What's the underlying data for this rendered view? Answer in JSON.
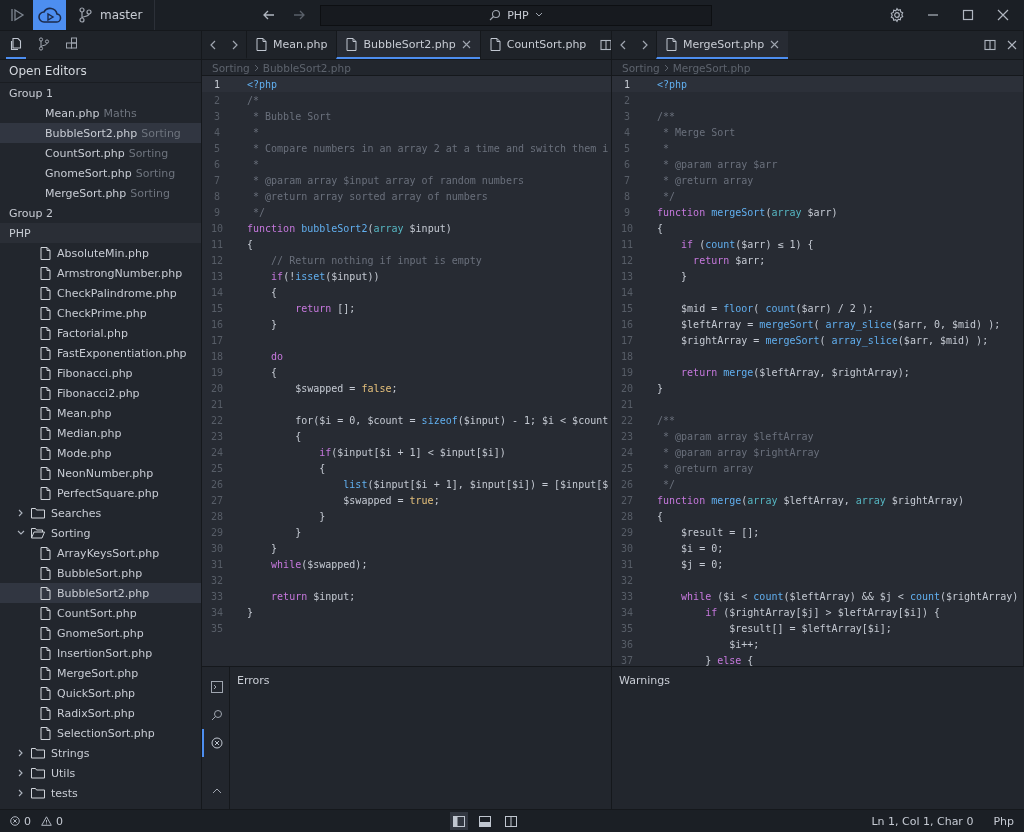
{
  "top_bar": {
    "branch": "master",
    "command": "PHP"
  },
  "sidebar": {
    "tabs": [
      {
        "kind": "files",
        "selected": true
      },
      {
        "kind": "branch",
        "selected": false
      },
      {
        "kind": "extensions",
        "selected": false
      }
    ],
    "open_editors": {
      "title": "Open Editors",
      "groups": [
        {
          "name": "Group 1",
          "items": [
            {
              "name": "Mean.php",
              "folder": "Maths",
              "selected": false
            },
            {
              "name": "BubbleSort2.php",
              "folder": "Sorting",
              "selected": true
            },
            {
              "name": "CountSort.php",
              "folder": "Sorting",
              "selected": false
            },
            {
              "name": "GnomeSort.php",
              "folder": "Sorting",
              "selected": false
            },
            {
              "name": "MergeSort.php",
              "folder": "Sorting",
              "selected": false
            }
          ]
        },
        {
          "name": "Group 2"
        }
      ]
    },
    "explorer": {
      "title": "PHP",
      "items": [
        {
          "kind": "file",
          "name": "AbsoluteMin.php",
          "selected": false
        },
        {
          "kind": "file",
          "name": "ArmstrongNumber.php",
          "selected": false
        },
        {
          "kind": "file",
          "name": "CheckPalindrome.php",
          "selected": false
        },
        {
          "kind": "file",
          "name": "CheckPrime.php",
          "selected": false
        },
        {
          "kind": "file",
          "name": "Factorial.php",
          "selected": false
        },
        {
          "kind": "file",
          "name": "FastExponentiation.php",
          "selected": false
        },
        {
          "kind": "file",
          "name": "Fibonacci.php",
          "selected": false
        },
        {
          "kind": "file",
          "name": "Fibonacci2.php",
          "selected": false
        },
        {
          "kind": "file",
          "name": "Mean.php",
          "selected": false
        },
        {
          "kind": "file",
          "name": "Median.php",
          "selected": false
        },
        {
          "kind": "file",
          "name": "Mode.php",
          "selected": false
        },
        {
          "kind": "file",
          "name": "NeonNumber.php",
          "selected": false
        },
        {
          "kind": "file",
          "name": "PerfectSquare.php",
          "selected": false
        },
        {
          "kind": "folder",
          "name": "Searches",
          "expanded": false
        },
        {
          "kind": "folder",
          "name": "Sorting",
          "expanded": true,
          "children": [
            {
              "kind": "file",
              "name": "ArrayKeysSort.php",
              "selected": false
            },
            {
              "kind": "file",
              "name": "BubbleSort.php",
              "selected": false
            },
            {
              "kind": "file",
              "name": "BubbleSort2.php",
              "selected": true
            },
            {
              "kind": "file",
              "name": "CountSort.php",
              "selected": false
            },
            {
              "kind": "file",
              "name": "GnomeSort.php",
              "selected": false
            },
            {
              "kind": "file",
              "name": "InsertionSort.php",
              "selected": false
            },
            {
              "kind": "file",
              "name": "MergeSort.php",
              "selected": false
            },
            {
              "kind": "file",
              "name": "QuickSort.php",
              "selected": false
            },
            {
              "kind": "file",
              "name": "RadixSort.php",
              "selected": false
            },
            {
              "kind": "file",
              "name": "SelectionSort.php",
              "selected": false
            }
          ]
        },
        {
          "kind": "folder",
          "name": "Strings",
          "expanded": false
        },
        {
          "kind": "folder",
          "name": "Utils",
          "expanded": false
        },
        {
          "kind": "folder",
          "name": "tests",
          "expanded": false
        }
      ]
    }
  },
  "editors": [
    {
      "tabs": [
        {
          "label": "Mean.php",
          "selected": false
        },
        {
          "label": "BubbleSort2.php",
          "selected": true
        },
        {
          "label": "CountSort.php",
          "selected": false
        }
      ],
      "breadcrumb": [
        "Sorting",
        "BubbleSort2.php"
      ],
      "lines": [
        {
          "n": "1",
          "current": true,
          "code": [
            {
              "kind": "tag",
              "text": "<?php"
            }
          ]
        },
        {
          "n": "2",
          "current": false,
          "code": [
            {
              "kind": "comment",
              "text": "/*"
            }
          ]
        },
        {
          "n": "3",
          "current": false,
          "code": [
            {
              "kind": "comment",
              "text": " * Bubble Sort"
            }
          ]
        },
        {
          "n": "4",
          "current": false,
          "code": [
            {
              "kind": "comment",
              "text": " *"
            }
          ]
        },
        {
          "n": "5",
          "current": false,
          "code": [
            {
              "kind": "comment",
              "text": " * Compare numbers in an array 2 at a time and switch them i"
            }
          ]
        },
        {
          "n": "6",
          "current": false,
          "code": [
            {
              "kind": "comment",
              "text": " *"
            }
          ]
        },
        {
          "n": "7",
          "current": false,
          "code": [
            {
              "kind": "comment",
              "text": " * @param array $input array of random numbers"
            }
          ]
        },
        {
          "n": "8",
          "current": false,
          "code": [
            {
              "kind": "comment",
              "text": " * @return array sorted array of numbers"
            }
          ]
        },
        {
          "n": "9",
          "current": false,
          "code": [
            {
              "kind": "comment",
              "text": " */"
            }
          ]
        },
        {
          "n": "10",
          "current": false,
          "code": [
            {
              "kind": "keyword",
              "text": "function "
            },
            {
              "kind": "function",
              "text": "bubbleSort2"
            },
            {
              "kind": "plain",
              "text": "("
            },
            {
              "kind": "type",
              "text": "array"
            },
            {
              "kind": "plain",
              "text": " $input)"
            }
          ]
        },
        {
          "n": "11",
          "current": false,
          "code": [
            {
              "kind": "plain",
              "text": "{"
            }
          ]
        },
        {
          "n": "12",
          "current": false,
          "code": [
            {
              "kind": "comment",
              "text": "    // Return nothing if input is empty"
            }
          ]
        },
        {
          "n": "13",
          "current": false,
          "code": [
            {
              "kind": "keyword",
              "text": "    if"
            },
            {
              "kind": "plain",
              "text": "(!"
            },
            {
              "kind": "function",
              "text": "isset"
            },
            {
              "kind": "plain",
              "text": "($input))"
            }
          ]
        },
        {
          "n": "14",
          "current": false,
          "code": [
            {
              "kind": "plain",
              "text": "    {"
            }
          ]
        },
        {
          "n": "15",
          "current": false,
          "code": [
            {
              "kind": "keyword",
              "text": "        return"
            },
            {
              "kind": "plain",
              "text": " [];"
            }
          ]
        },
        {
          "n": "16",
          "current": false,
          "code": [
            {
              "kind": "plain",
              "text": "    }"
            }
          ]
        },
        {
          "n": "17",
          "current": false
        },
        {
          "n": "18",
          "current": false,
          "code": [
            {
              "kind": "keyword",
              "text": "    do"
            }
          ]
        },
        {
          "n": "19",
          "current": false,
          "code": [
            {
              "kind": "plain",
              "text": "    {"
            }
          ]
        },
        {
          "n": "20",
          "current": false,
          "code": [
            {
              "kind": "plain",
              "text": "        $swapped = "
            },
            {
              "kind": "constant",
              "text": "false"
            },
            {
              "kind": "plain",
              "text": ";"
            }
          ]
        },
        {
          "n": "21",
          "current": false
        },
        {
          "n": "22",
          "current": false,
          "code": [
            {
              "kind": "plain",
              "text": "        for($i = 0, $count = "
            },
            {
              "kind": "function",
              "text": "sizeof"
            },
            {
              "kind": "plain",
              "text": "($input) - 1; $i < $count"
            }
          ]
        },
        {
          "n": "23",
          "current": false,
          "code": [
            {
              "kind": "plain",
              "text": "        {"
            }
          ]
        },
        {
          "n": "24",
          "current": false,
          "code": [
            {
              "kind": "keyword",
              "text": "            if"
            },
            {
              "kind": "plain",
              "text": "($input[$i + 1] < $input[$i])"
            }
          ]
        },
        {
          "n": "25",
          "current": false,
          "code": [
            {
              "kind": "plain",
              "text": "            {"
            }
          ]
        },
        {
          "n": "26",
          "current": false,
          "code": [
            {
              "kind": "function",
              "text": "                list"
            },
            {
              "kind": "plain",
              "text": "($input[$i + 1], $input[$i]) = [$input[$"
            }
          ]
        },
        {
          "n": "27",
          "current": false,
          "code": [
            {
              "kind": "plain",
              "text": "                $swapped = "
            },
            {
              "kind": "constant",
              "text": "true"
            },
            {
              "kind": "plain",
              "text": ";"
            }
          ]
        },
        {
          "n": "28",
          "current": false,
          "code": [
            {
              "kind": "plain",
              "text": "            }"
            }
          ]
        },
        {
          "n": "29",
          "current": false,
          "code": [
            {
              "kind": "plain",
              "text": "        }"
            }
          ]
        },
        {
          "n": "30",
          "current": false,
          "code": [
            {
              "kind": "plain",
              "text": "    }"
            }
          ]
        },
        {
          "n": "31",
          "current": false,
          "code": [
            {
              "kind": "keyword",
              "text": "    while"
            },
            {
              "kind": "plain",
              "text": "($swapped);"
            }
          ]
        },
        {
          "n": "32",
          "current": false
        },
        {
          "n": "33",
          "current": false,
          "code": [
            {
              "kind": "keyword",
              "text": "    return"
            },
            {
              "kind": "plain",
              "text": " $input;"
            }
          ]
        },
        {
          "n": "34",
          "current": false,
          "code": [
            {
              "kind": "plain",
              "text": "}"
            }
          ]
        },
        {
          "n": "35",
          "current": false
        }
      ]
    },
    {
      "tabs": [
        {
          "label": "MergeSort.php",
          "selected": true
        }
      ],
      "breadcrumb": [
        "Sorting",
        "MergeSort.php"
      ],
      "lines": [
        {
          "n": "1",
          "current": true,
          "code": [
            {
              "kind": "tag",
              "text": "<?php"
            }
          ]
        },
        {
          "n": "2",
          "current": false
        },
        {
          "n": "3",
          "current": false,
          "code": [
            {
              "kind": "comment",
              "text": "/**"
            }
          ]
        },
        {
          "n": "4",
          "current": false,
          "code": [
            {
              "kind": "comment",
              "text": " * Merge Sort"
            }
          ]
        },
        {
          "n": "5",
          "current": false,
          "code": [
            {
              "kind": "comment",
              "text": " *"
            }
          ]
        },
        {
          "n": "6",
          "current": false,
          "code": [
            {
              "kind": "comment",
              "text": " * @param array $arr"
            }
          ]
        },
        {
          "n": "7",
          "current": false,
          "code": [
            {
              "kind": "comment",
              "text": " * @return array"
            }
          ]
        },
        {
          "n": "8",
          "current": false,
          "code": [
            {
              "kind": "comment",
              "text": " */"
            }
          ]
        },
        {
          "n": "9",
          "current": false,
          "code": [
            {
              "kind": "keyword",
              "text": "function "
            },
            {
              "kind": "function",
              "text": "mergeSort"
            },
            {
              "kind": "plain",
              "text": "("
            },
            {
              "kind": "type",
              "text": "array"
            },
            {
              "kind": "plain",
              "text": " $arr)"
            }
          ]
        },
        {
          "n": "10",
          "current": false,
          "code": [
            {
              "kind": "plain",
              "text": "{"
            }
          ]
        },
        {
          "n": "11",
          "current": false,
          "code": [
            {
              "kind": "keyword",
              "text": "    if"
            },
            {
              "kind": "plain",
              "text": " ("
            },
            {
              "kind": "function",
              "text": "count"
            },
            {
              "kind": "plain",
              "text": "($arr) ≤ 1) {"
            }
          ]
        },
        {
          "n": "12",
          "current": false,
          "code": [
            {
              "kind": "keyword",
              "text": "      return"
            },
            {
              "kind": "plain",
              "text": " $arr;"
            }
          ]
        },
        {
          "n": "13",
          "current": false,
          "code": [
            {
              "kind": "plain",
              "text": "    }"
            }
          ]
        },
        {
          "n": "14",
          "current": false
        },
        {
          "n": "15",
          "current": false,
          "code": [
            {
              "kind": "plain",
              "text": "    $mid = "
            },
            {
              "kind": "function",
              "text": "floor"
            },
            {
              "kind": "plain",
              "text": "( "
            },
            {
              "kind": "function",
              "text": "count"
            },
            {
              "kind": "plain",
              "text": "($arr) / 2 );"
            }
          ]
        },
        {
          "n": "16",
          "current": false,
          "code": [
            {
              "kind": "plain",
              "text": "    $leftArray = "
            },
            {
              "kind": "function",
              "text": "mergeSort"
            },
            {
              "kind": "plain",
              "text": "( "
            },
            {
              "kind": "function",
              "text": "array_slice"
            },
            {
              "kind": "plain",
              "text": "($arr, 0, $mid) );"
            }
          ]
        },
        {
          "n": "17",
          "current": false,
          "code": [
            {
              "kind": "plain",
              "text": "    $rightArray = "
            },
            {
              "kind": "function",
              "text": "mergeSort"
            },
            {
              "kind": "plain",
              "text": "( "
            },
            {
              "kind": "function",
              "text": "array_slice"
            },
            {
              "kind": "plain",
              "text": "($arr, $mid) );"
            }
          ]
        },
        {
          "n": "18",
          "current": false
        },
        {
          "n": "19",
          "current": false,
          "code": [
            {
              "kind": "keyword",
              "text": "    return"
            },
            {
              "kind": "function",
              "text": " merge"
            },
            {
              "kind": "plain",
              "text": "($leftArray, $rightArray);"
            }
          ]
        },
        {
          "n": "20",
          "current": false,
          "code": [
            {
              "kind": "plain",
              "text": "}"
            }
          ]
        },
        {
          "n": "21",
          "current": false
        },
        {
          "n": "22",
          "current": false,
          "code": [
            {
              "kind": "comment",
              "text": "/**"
            }
          ]
        },
        {
          "n": "23",
          "current": false,
          "code": [
            {
              "kind": "comment",
              "text": " * @param array $leftArray"
            }
          ]
        },
        {
          "n": "24",
          "current": false,
          "code": [
            {
              "kind": "comment",
              "text": " * @param array $rightArray"
            }
          ]
        },
        {
          "n": "25",
          "current": false,
          "code": [
            {
              "kind": "comment",
              "text": " * @return array"
            }
          ]
        },
        {
          "n": "26",
          "current": false,
          "code": [
            {
              "kind": "comment",
              "text": " */"
            }
          ]
        },
        {
          "n": "27",
          "current": false,
          "code": [
            {
              "kind": "keyword",
              "text": "function "
            },
            {
              "kind": "function",
              "text": "merge"
            },
            {
              "kind": "plain",
              "text": "("
            },
            {
              "kind": "type",
              "text": "array"
            },
            {
              "kind": "plain",
              "text": " $leftArray, "
            },
            {
              "kind": "type",
              "text": "array"
            },
            {
              "kind": "plain",
              "text": " $rightArray)"
            }
          ]
        },
        {
          "n": "28",
          "current": false,
          "code": [
            {
              "kind": "plain",
              "text": "{"
            }
          ]
        },
        {
          "n": "29",
          "current": false,
          "code": [
            {
              "kind": "plain",
              "text": "    $result = [];"
            }
          ]
        },
        {
          "n": "30",
          "current": false,
          "code": [
            {
              "kind": "plain",
              "text": "    $i = 0;"
            }
          ]
        },
        {
          "n": "31",
          "current": false,
          "code": [
            {
              "kind": "plain",
              "text": "    $j = 0;"
            }
          ]
        },
        {
          "n": "32",
          "current": false
        },
        {
          "n": "33",
          "current": false,
          "code": [
            {
              "kind": "keyword",
              "text": "    while"
            },
            {
              "kind": "plain",
              "text": " ($i < "
            },
            {
              "kind": "function",
              "text": "count"
            },
            {
              "kind": "plain",
              "text": "($leftArray) && $j < "
            },
            {
              "kind": "function",
              "text": "count"
            },
            {
              "kind": "plain",
              "text": "($rightArray)"
            }
          ]
        },
        {
          "n": "34",
          "current": false,
          "code": [
            {
              "kind": "keyword",
              "text": "        if"
            },
            {
              "kind": "plain",
              "text": " ($rightArray[$j] > $leftArray[$i]) {"
            }
          ]
        },
        {
          "n": "35",
          "current": false,
          "code": [
            {
              "kind": "plain",
              "text": "            $result[] = $leftArray[$i];"
            }
          ]
        },
        {
          "n": "36",
          "current": false,
          "code": [
            {
              "kind": "plain",
              "text": "            $i++;"
            }
          ]
        },
        {
          "n": "37",
          "current": false,
          "code": [
            {
              "kind": "plain",
              "text": "        } "
            },
            {
              "kind": "keyword",
              "text": "else"
            },
            {
              "kind": "plain",
              "text": " {"
            }
          ]
        }
      ]
    }
  ],
  "panel": {
    "tools": [
      {
        "kind": "terminal",
        "selected": false
      },
      {
        "kind": "search",
        "selected": false
      },
      {
        "kind": "problems",
        "selected": true
      },
      {
        "kind": "collapse",
        "selected": false
      }
    ],
    "sections": [
      "Errors",
      "Warnings"
    ]
  },
  "status_bar": {
    "errors": "0",
    "warnings": "0",
    "layouts": [
      {
        "kind": "sidebar",
        "selected": true
      },
      {
        "kind": "panel",
        "selected": false
      },
      {
        "kind": "split",
        "selected": false
      }
    ],
    "position": "Ln 1, Col 1, Char 0",
    "language": "Php"
  }
}
